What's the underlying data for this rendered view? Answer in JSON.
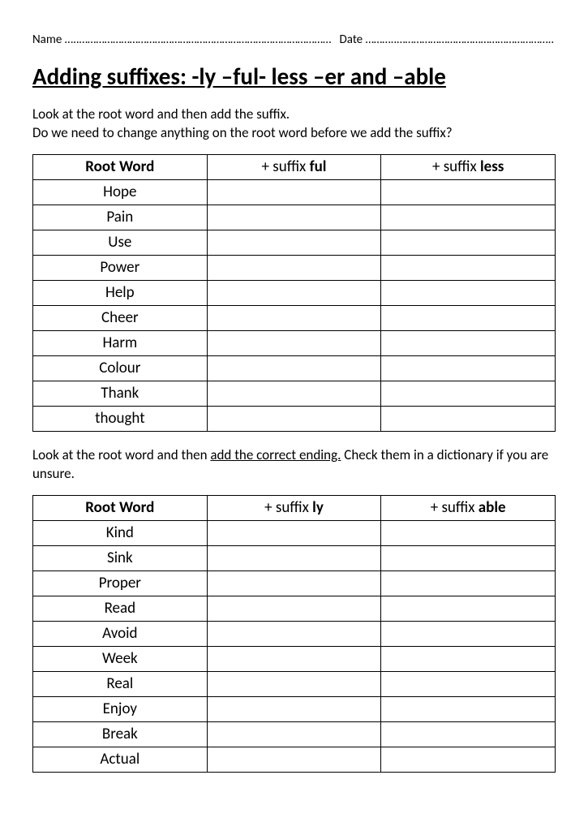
{
  "header": {
    "name_label": "Name",
    "name_dots": "…..………………………………………………………………………………",
    "date_label": "Date",
    "date_dots": "………..……………………………………………….."
  },
  "title": "Adding suffixes:  -ly –ful- less –er  and –able",
  "instr1_line1": "Look at the root word and then add the suffix.",
  "instr1_line2": " Do we need to change anything on the root word before we add the suffix?",
  "table1": {
    "h1": "Root Word",
    "h2_prefix": "+ suffix ",
    "h2_bold": "ful",
    "h3_prefix": "+ suffix ",
    "h3_bold": "less",
    "rows": [
      "Hope",
      "Pain",
      "Use",
      "Power",
      "Help",
      "Cheer",
      "Harm",
      "Colour",
      "Thank",
      "thought"
    ]
  },
  "instr2_pre": "Look at the root word and then ",
  "instr2_underline": "add the correct ending.",
  "instr2_post": "  Check them in a dictionary if you are unsure.",
  "table2": {
    "h1": "Root Word",
    "h2_prefix": "+ suffix ",
    "h2_bold": "ly",
    "h3_prefix": "+ suffix ",
    "h3_bold": "able",
    "rows": [
      "Kind",
      "Sink",
      "Proper",
      "Read",
      "Avoid",
      "Week",
      "Real",
      "Enjoy",
      "Break",
      "Actual"
    ]
  }
}
